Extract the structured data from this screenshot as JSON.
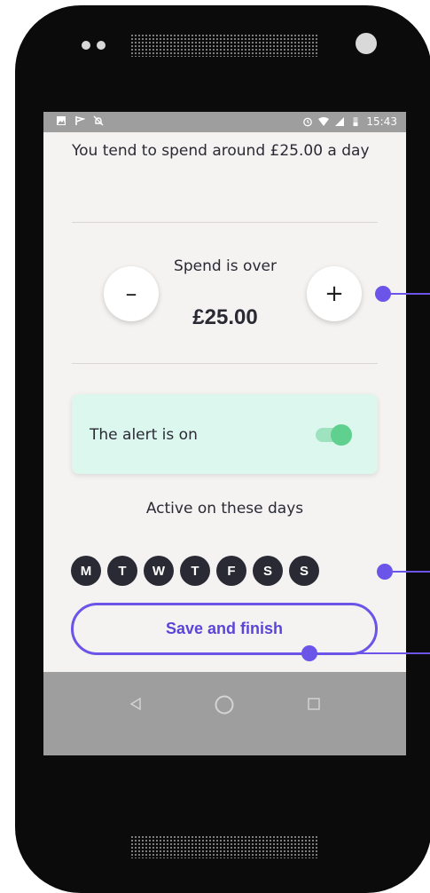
{
  "status_bar": {
    "time": "15:43"
  },
  "intro": {
    "text": "You tend to spend around £25.00 a day"
  },
  "spend": {
    "label": "Spend is over",
    "amount": "£25.00",
    "minus_label": "–",
    "plus_label": "+"
  },
  "alert": {
    "label": "The alert is on",
    "enabled": true
  },
  "days": {
    "label": "Active on these days",
    "items": [
      "M",
      "T",
      "W",
      "T",
      "F",
      "S",
      "S"
    ]
  },
  "save": {
    "label": "Save and finish"
  },
  "colors": {
    "accent": "#6b55e8",
    "toggle_on": "#5fd08e",
    "card_bg": "#dcf8ee",
    "day_bg": "#2a2a35"
  }
}
